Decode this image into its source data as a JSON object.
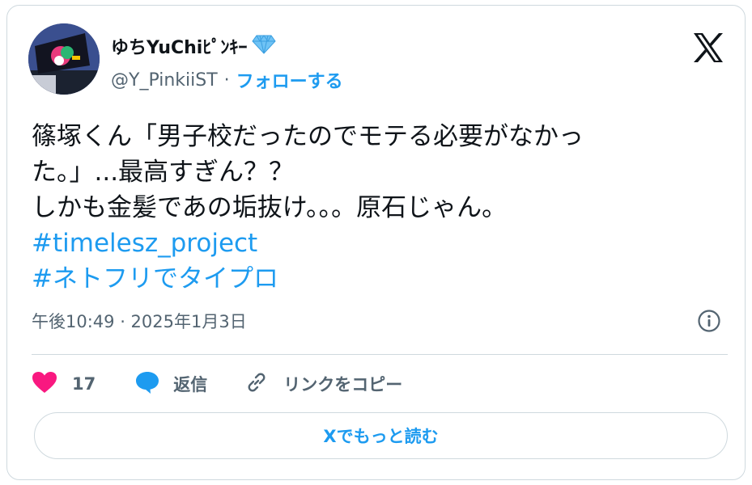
{
  "user": {
    "display_name": "ゆちYuChiﾋﾟﾝｷｰ",
    "handle": "@Y_PinkiiST",
    "separator": "·",
    "follow_label": "フォローする"
  },
  "tweet": {
    "lines": [
      "篠塚くん「男子校だったのでモテる必要がなかっ",
      "た。」...最高すぎん？？",
      "しかも金髪であの垢抜け。。。原石じゃん。"
    ],
    "hashtags": [
      "#timelesz_project",
      "#ネトフリでタイプロ"
    ],
    "timestamp": "午後10:49 · 2025年1月3日"
  },
  "actions": {
    "like_count": "17",
    "reply_label": "返信",
    "copy_link_label": "リンクをコピー"
  },
  "read_more_label": "Xでもっと読む",
  "colors": {
    "accent": "#1d9bf0",
    "like": "#f91880",
    "text": "#0f1419",
    "muted": "#536471",
    "border": "#cfd9de"
  },
  "icons": {
    "badge": "diamond-icon",
    "brand": "x-logo-icon",
    "info": "info-icon",
    "like": "heart-icon",
    "reply": "speech-bubble-icon",
    "copy": "link-icon"
  }
}
